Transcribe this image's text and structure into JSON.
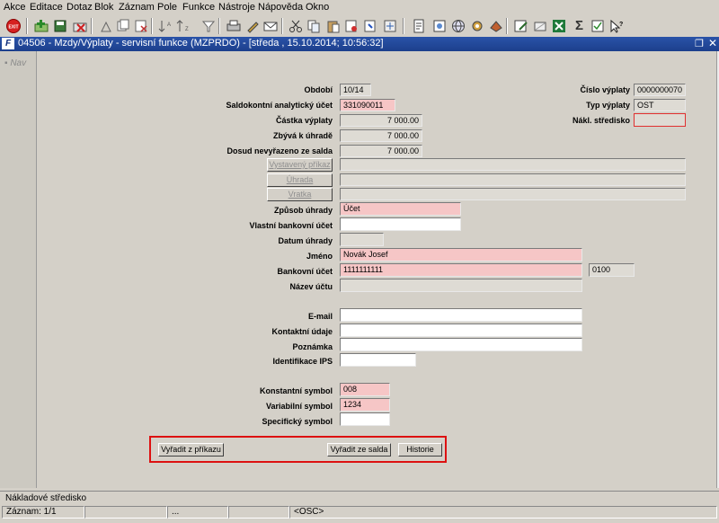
{
  "menu": [
    "Akce",
    "Editace",
    "Dotaz",
    "Blok",
    "Záznam",
    "Pole",
    "Funkce",
    "Nástroje",
    "Nápověda",
    "Okno"
  ],
  "toolbar": {
    "exit_label": "EXIT",
    "icons": [
      "exit-icon",
      "new-record-icon",
      "save-icon",
      "delete-record-icon",
      "cut-icon",
      "duplicate-icon",
      "remove-icon",
      "sort-ascending-icon",
      "sort-descending-icon",
      "filter-icon",
      "print-icon",
      "edit-icon",
      "mail-icon",
      "scissors-icon",
      "copy-icon",
      "paste-icon",
      "clear-icon",
      "help-icon",
      "calculator-icon",
      "document-icon",
      "settings-icon",
      "globe-icon",
      "tools-icon",
      "export-icon",
      "edit-page-icon",
      "excel-icon",
      "sum-icon",
      "checklist-icon",
      "help-cursor-icon"
    ],
    "sum_glyph": "Σ"
  },
  "window": {
    "title": "04506 - Mzdy/Výplaty - servisní funkce (MZPRDO) - [středa , 15.10.2014; 10:56:32]",
    "nav_label": "Nav"
  },
  "form": {
    "obdobi": {
      "label": "Období",
      "value": "10/14"
    },
    "saldokontni": {
      "label": "Saldokontní analytický účet",
      "value": "331090011"
    },
    "castka": {
      "label": "Částka výplaty",
      "value": "7 000.00"
    },
    "zbyva": {
      "label": "Zbývá k úhradě",
      "value": "7 000.00"
    },
    "dosud": {
      "label": "Dosud nevyřazeno ze salda",
      "value": "7 000.00"
    },
    "cislo_vyplaty": {
      "label": "Číslo výplaty",
      "value": "0000000070"
    },
    "typ_vyplaty": {
      "label": "Typ výplaty",
      "value": "OST"
    },
    "nakl_stredisko": {
      "label": "Nákl. středisko",
      "value": ""
    },
    "vystaveny_prikaz": {
      "label": "Vystavený příkaz",
      "value": ""
    },
    "uhrada": {
      "label": "Úhrada",
      "value": ""
    },
    "vratka": {
      "label": "Vratka",
      "value": ""
    },
    "zpusob_uhrady": {
      "label": "Způsob úhrady",
      "value": "Účet"
    },
    "vlastni_ucet": {
      "label": "Vlastní bankovní účet",
      "value": ""
    },
    "datum_uhrady": {
      "label": "Datum úhrady",
      "value": ""
    },
    "jmeno": {
      "label": "Jméno",
      "value": "Novák Josef"
    },
    "bankovni_ucet": {
      "label": "Bankovní účet",
      "value": "1111111111",
      "bank_code": "0100"
    },
    "nazev_uctu": {
      "label": "Název účtu",
      "value": ""
    },
    "email": {
      "label": "E-mail",
      "value": ""
    },
    "kontaktni": {
      "label": "Kontaktní údaje",
      "value": ""
    },
    "poznamka": {
      "label": "Poznámka",
      "value": ""
    },
    "ips": {
      "label": "Identifikace IPS",
      "value": ""
    },
    "konst_symbol": {
      "label": "Konstantní symbol",
      "value": "008"
    },
    "var_symbol": {
      "label": "Variabilní symbol",
      "value": "1234"
    },
    "spec_symbol": {
      "label": "Specifický symbol",
      "value": ""
    }
  },
  "buttons": {
    "vyradit_prikaz": "Vyřadit z příkazu",
    "vyradit_salda": "Vyřadit ze salda",
    "historie": "Historie"
  },
  "status": {
    "message": "Nákladové středisko",
    "record": "Záznam: 1/1",
    "cell2": "",
    "cell3": "...",
    "cell4": "",
    "mode": "<OSC>"
  }
}
